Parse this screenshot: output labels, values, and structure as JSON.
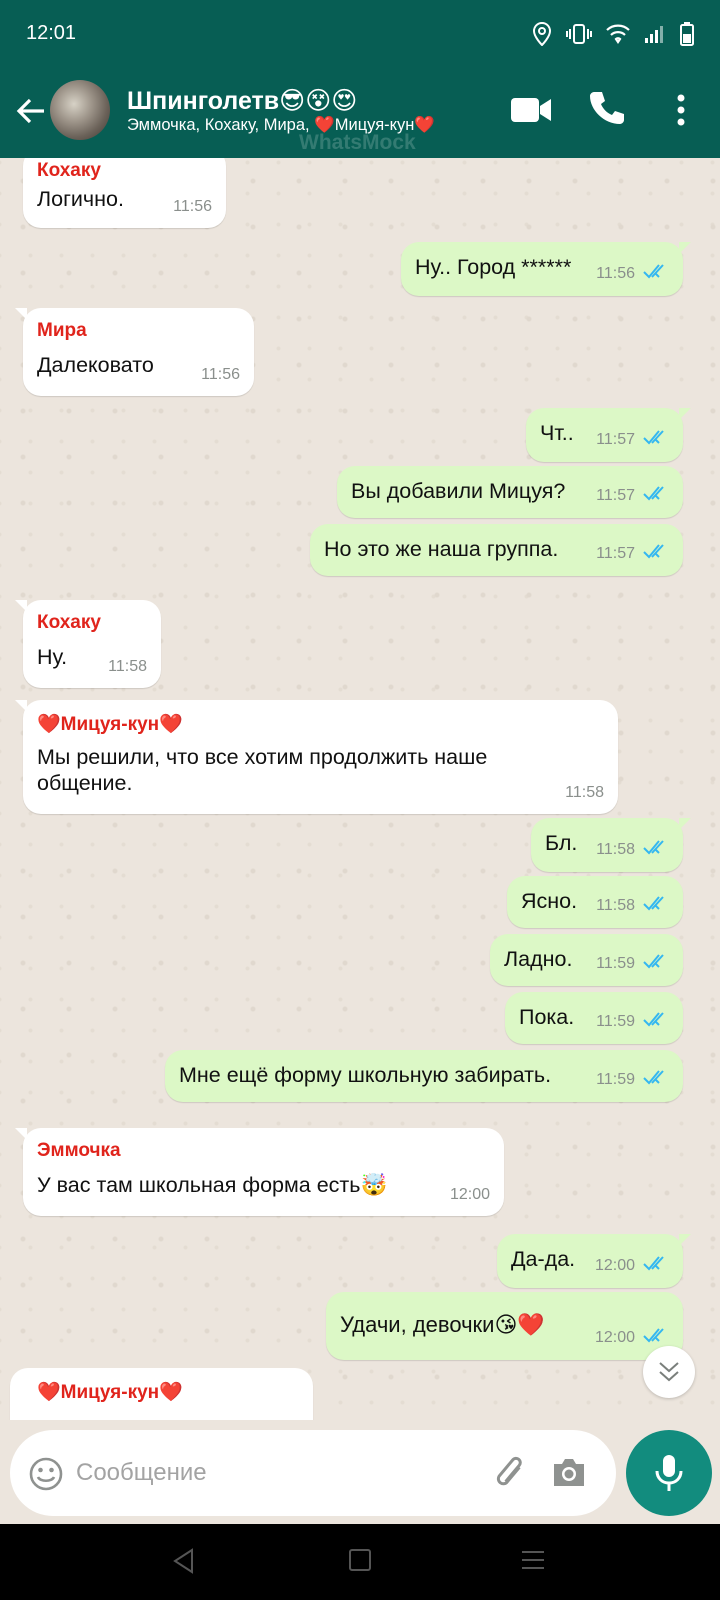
{
  "status_bar": {
    "time": "12:01"
  },
  "header": {
    "title": "Шпинголетв😎😵😍",
    "subtitle": "Эммочка, Кохаку, Мира, ❤️Мицуя-кун❤️",
    "watermark": "WhatsMock"
  },
  "messages": [
    {
      "dir": "in",
      "sender": "Кохаку",
      "text": "Логично.",
      "time": "11:56"
    },
    {
      "dir": "out",
      "text": "Ну.. Город ******",
      "time": "11:56",
      "status": "read"
    },
    {
      "dir": "in",
      "sender": "Мира",
      "text": "Далековато",
      "time": "11:56"
    },
    {
      "dir": "out",
      "text": "Чт..",
      "time": "11:57",
      "status": "read"
    },
    {
      "dir": "out",
      "text": "Вы добавили Мицуя?",
      "time": "11:57",
      "status": "read"
    },
    {
      "dir": "out",
      "text": "Но это же наша группа.",
      "time": "11:57",
      "status": "read"
    },
    {
      "dir": "in",
      "sender": "Кохаку",
      "text": "Ну.",
      "time": "11:58"
    },
    {
      "dir": "in",
      "sender": "❤️Мицуя-кун❤️",
      "text_line1": "Мы решили, что все хотим продолжить наше",
      "text_line2": "общение.",
      "time": "11:58"
    },
    {
      "dir": "out",
      "text": "Бл.",
      "time": "11:58",
      "status": "read"
    },
    {
      "dir": "out",
      "text": "Ясно.",
      "time": "11:58",
      "status": "read"
    },
    {
      "dir": "out",
      "text": "Ладно.",
      "time": "11:59",
      "status": "read"
    },
    {
      "dir": "out",
      "text": "Пока.",
      "time": "11:59",
      "status": "read"
    },
    {
      "dir": "out",
      "text": "Мне ещё форму школьную забирать.",
      "time": "11:59",
      "status": "read"
    },
    {
      "dir": "in",
      "sender": "Эммочка",
      "text": "У вас там школьная форма есть🤯",
      "time": "12:00"
    },
    {
      "dir": "out",
      "text": "Да-да.",
      "time": "12:00",
      "status": "read"
    },
    {
      "dir": "out",
      "text": "Удачи, девочки😘❤️",
      "time": "12:00",
      "status": "read"
    },
    {
      "dir": "in",
      "sender": "❤️Мицуя-кун❤️",
      "partial": true
    }
  ],
  "composer": {
    "placeholder": "Сообщение"
  },
  "icons": {
    "back": "arrow-left-icon",
    "video": "video-call-icon",
    "call": "phone-icon",
    "menu": "more-vertical-icon",
    "emoji": "emoji-icon",
    "attach": "paperclip-icon",
    "camera": "camera-icon",
    "mic": "microphone-icon",
    "read": "double-check-icon",
    "scroll": "chevrons-down-icon"
  },
  "colors": {
    "header": "#075E54",
    "incoming": "#FFFFFF",
    "outgoing": "#DCF8C6",
    "sender_name": "#E0241C",
    "read_tick": "#34B7F1",
    "chat_bg": "#ECE5DD",
    "mic_button": "#128C7E"
  }
}
